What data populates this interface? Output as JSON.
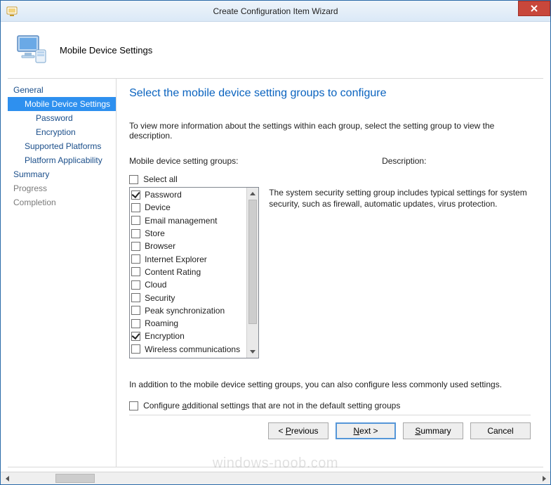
{
  "window": {
    "title": "Create Configuration Item Wizard",
    "close_tooltip": "Close"
  },
  "banner": {
    "page_name": "Mobile Device Settings"
  },
  "nav": {
    "items": [
      {
        "label": "General",
        "indent": 0,
        "type": "link",
        "selected": false
      },
      {
        "label": "Mobile Device Settings",
        "indent": 1,
        "type": "selected",
        "selected": true
      },
      {
        "label": "Password",
        "indent": 2,
        "type": "link",
        "selected": false
      },
      {
        "label": "Encryption",
        "indent": 2,
        "type": "link",
        "selected": false
      },
      {
        "label": "Supported Platforms",
        "indent": 1,
        "type": "link",
        "selected": false
      },
      {
        "label": "Platform Applicability",
        "indent": 1,
        "type": "link",
        "selected": false
      },
      {
        "label": "Summary",
        "indent": 0,
        "type": "link",
        "selected": false
      },
      {
        "label": "Progress",
        "indent": 0,
        "type": "muted",
        "selected": false
      },
      {
        "label": "Completion",
        "indent": 0,
        "type": "muted",
        "selected": false
      }
    ]
  },
  "content": {
    "heading": "Select the mobile device setting groups to configure",
    "intro": "To view more information about the settings within each group, select the setting group to view the description.",
    "groups_label": "Mobile device setting groups:",
    "description_label": "Description:",
    "select_all_label": "Select all",
    "select_all_checked": false,
    "groups": [
      {
        "label": "Password",
        "checked": true
      },
      {
        "label": "Device",
        "checked": false
      },
      {
        "label": "Email management",
        "checked": false
      },
      {
        "label": "Store",
        "checked": false
      },
      {
        "label": "Browser",
        "checked": false
      },
      {
        "label": "Internet Explorer",
        "checked": false
      },
      {
        "label": "Content Rating",
        "checked": false
      },
      {
        "label": "Cloud",
        "checked": false
      },
      {
        "label": "Security",
        "checked": false
      },
      {
        "label": "Peak synchronization",
        "checked": false
      },
      {
        "label": "Roaming",
        "checked": false
      },
      {
        "label": "Encryption",
        "checked": true
      },
      {
        "label": "Wireless communications",
        "checked": false
      }
    ],
    "description_text": "The system security setting group includes typical settings for system security, such as firewall, automatic updates, virus protection.",
    "addition_note": "In addition to the mobile device setting groups, you can also configure less commonly used settings.",
    "configure_additional_label_pre": "Configure ",
    "configure_additional_label_u": "a",
    "configure_additional_label_post": "dditional settings that are not in the default setting groups",
    "configure_additional_checked": false
  },
  "footer": {
    "previous_pre": "< ",
    "previous_u": "P",
    "previous_post": "revious",
    "next_pre": "",
    "next_u": "N",
    "next_post": "ext >",
    "summary_pre": "",
    "summary_u": "S",
    "summary_post": "ummary",
    "cancel": "Cancel"
  },
  "watermark": "windows-noob.com"
}
